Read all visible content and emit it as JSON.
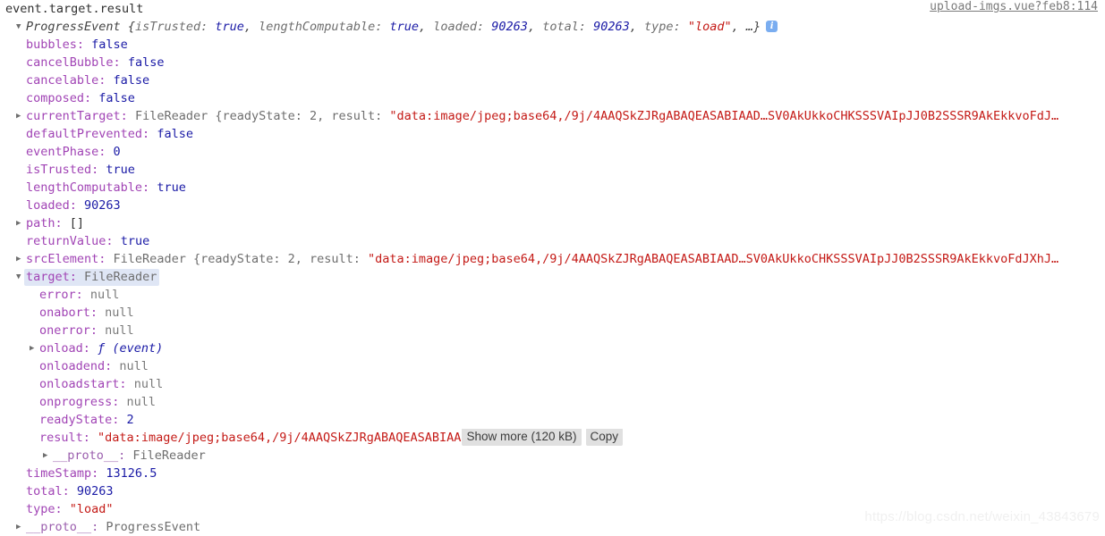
{
  "source_link": {
    "label": "upload-imgs.vue?feb8:114"
  },
  "watermark": {
    "text": "https://blog.csdn.net/weixin_43843679"
  },
  "console": {
    "echo_line": "event.target.result",
    "preview": {
      "class_name": "ProgressEvent",
      "open_brace": "{",
      "entries": [
        {
          "key": "isTrusted:",
          "value": "true",
          "kind": "bool"
        },
        {
          "key": "lengthComputable:",
          "value": "true",
          "kind": "bool"
        },
        {
          "key": "loaded:",
          "value": "90263",
          "kind": "num"
        },
        {
          "key": "total:",
          "value": "90263",
          "kind": "num"
        },
        {
          "key": "type:",
          "value": "\"load\"",
          "kind": "str"
        }
      ],
      "ellipsis": "…",
      "close_brace": "}",
      "info_icon": "info-icon"
    },
    "buttons": {
      "show_more": "Show more (120 kB)",
      "copy": "Copy"
    },
    "rows": [
      {
        "id": "bubbles",
        "indent": 1,
        "tri": "blank",
        "key": "bubbles:",
        "value": "false",
        "kind": "bool"
      },
      {
        "id": "cancelBubble",
        "indent": 1,
        "tri": "blank",
        "key": "cancelBubble:",
        "value": "false",
        "kind": "bool"
      },
      {
        "id": "cancelable",
        "indent": 1,
        "tri": "blank",
        "key": "cancelable:",
        "value": "false",
        "kind": "bool"
      },
      {
        "id": "composed",
        "indent": 1,
        "tri": "blank",
        "key": "composed:",
        "value": "false",
        "kind": "bool"
      },
      {
        "id": "currentTarget",
        "indent": 1,
        "tri": "closed",
        "key": "currentTarget:",
        "kind": "objpreview",
        "class_name": "FileReader",
        "preview_text": "{readyState: 2, result: \"data:image/jpeg;base64,/9j/4AAQSkZJRgABAQEASABIAAD…SV0AkUkkoCHKSSSVAIpJJ0B2SSSR9AkEkkvoFdJ…"
      },
      {
        "id": "defaultPrevented",
        "indent": 1,
        "tri": "blank",
        "key": "defaultPrevented:",
        "value": "false",
        "kind": "bool"
      },
      {
        "id": "eventPhase",
        "indent": 1,
        "tri": "blank",
        "key": "eventPhase:",
        "value": "0",
        "kind": "num"
      },
      {
        "id": "isTrusted",
        "indent": 1,
        "tri": "blank",
        "key": "isTrusted:",
        "value": "true",
        "kind": "bool"
      },
      {
        "id": "lengthComputable",
        "indent": 1,
        "tri": "blank",
        "key": "lengthComputable:",
        "value": "true",
        "kind": "bool"
      },
      {
        "id": "loaded",
        "indent": 1,
        "tri": "blank",
        "key": "loaded:",
        "value": "90263",
        "kind": "num"
      },
      {
        "id": "path",
        "indent": 1,
        "tri": "closed",
        "key": "path:",
        "value": "[]",
        "kind": "plain"
      },
      {
        "id": "returnValue",
        "indent": 1,
        "tri": "blank",
        "key": "returnValue:",
        "value": "true",
        "kind": "bool"
      },
      {
        "id": "srcElement",
        "indent": 1,
        "tri": "closed",
        "key": "srcElement:",
        "kind": "objpreview",
        "class_name": "FileReader",
        "preview_text": "{readyState: 2, result: \"data:image/jpeg;base64,/9j/4AAQSkZJRgABAQEASABIAAD…SV0AkUkkoCHKSSSVAIpJJ0B2SSSR9AkEkkvoFdJXhJ…"
      },
      {
        "id": "target",
        "indent": 1,
        "tri": "open",
        "key": "target:",
        "kind": "objhl",
        "class_name": "FileReader"
      },
      {
        "id": "error",
        "indent": 2,
        "tri": "blank",
        "key": "error:",
        "value": "null",
        "kind": "null"
      },
      {
        "id": "onabort",
        "indent": 2,
        "tri": "blank",
        "key": "onabort:",
        "value": "null",
        "kind": "null"
      },
      {
        "id": "onerror",
        "indent": 2,
        "tri": "blank",
        "key": "onerror:",
        "value": "null",
        "kind": "null"
      },
      {
        "id": "onload",
        "indent": 2,
        "tri": "closed",
        "key": "onload:",
        "value": "(event)",
        "kind": "fn",
        "fn_symbol": "ƒ"
      },
      {
        "id": "onloadend",
        "indent": 2,
        "tri": "blank",
        "key": "onloadend:",
        "value": "null",
        "kind": "null"
      },
      {
        "id": "onloadstart",
        "indent": 2,
        "tri": "blank",
        "key": "onloadstart:",
        "value": "null",
        "kind": "null"
      },
      {
        "id": "onprogress",
        "indent": 2,
        "tri": "blank",
        "key": "onprogress:",
        "value": "null",
        "kind": "null"
      },
      {
        "id": "readyState",
        "indent": 2,
        "tri": "blank",
        "key": "readyState:",
        "value": "2",
        "kind": "num"
      },
      {
        "id": "result",
        "indent": 2,
        "tri": "blank",
        "key": "result:",
        "kind": "resultstr",
        "value": "\"data:image/jpeg;base64,/9j/4AAQSkZJRgABAQEASABIAA"
      },
      {
        "id": "proto-filereader",
        "indent": 3,
        "tri": "closed",
        "key": "__proto__:",
        "value": "FileReader",
        "kind": "protoclass"
      },
      {
        "id": "timeStamp",
        "indent": 1,
        "tri": "blank",
        "key": "timeStamp:",
        "value": "13126.5",
        "kind": "num"
      },
      {
        "id": "total",
        "indent": 1,
        "tri": "blank",
        "key": "total:",
        "value": "90263",
        "kind": "num"
      },
      {
        "id": "type",
        "indent": 1,
        "tri": "blank",
        "key": "type:",
        "value": "\"load\"",
        "kind": "str"
      },
      {
        "id": "proto-progressevent",
        "indent": 1,
        "tri": "closed",
        "key": "__proto__:",
        "value": "ProgressEvent",
        "kind": "protoclass"
      }
    ]
  }
}
